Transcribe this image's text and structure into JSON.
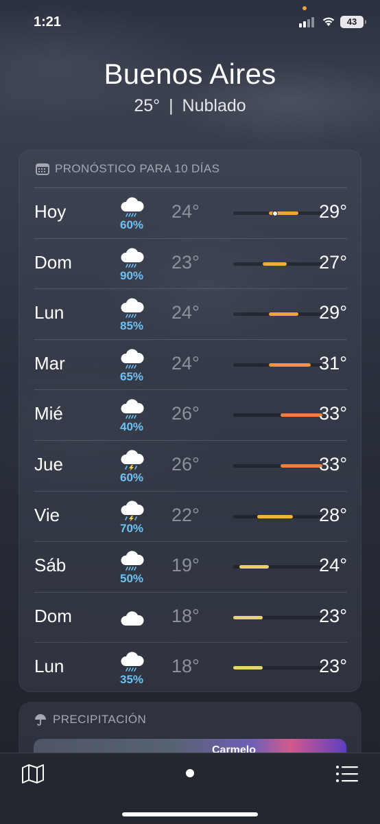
{
  "status_bar": {
    "time": "1:21",
    "battery": "43"
  },
  "header": {
    "city": "Buenos Aires",
    "temp": "25°",
    "separator": "|",
    "condition": "Nublado"
  },
  "forecast": {
    "title": "PRONÓSTICO PARA 10 DÍAS",
    "scale": {
      "min": 18,
      "max": 33
    },
    "days": [
      {
        "day": "Hoy",
        "icon": "rain-icon",
        "precip": "60%",
        "low": "24°",
        "high": "29°",
        "lo": 24,
        "hi": 29,
        "now": 25,
        "color": "#f2a23c"
      },
      {
        "day": "Dom",
        "icon": "rain-icon",
        "precip": "90%",
        "low": "23°",
        "high": "27°",
        "lo": 23,
        "hi": 27,
        "color": "#f3ad3a"
      },
      {
        "day": "Lun",
        "icon": "rain-icon",
        "precip": "85%",
        "low": "24°",
        "high": "29°",
        "lo": 24,
        "hi": 29,
        "color": "#f2a23c"
      },
      {
        "day": "Mar",
        "icon": "rain-icon",
        "precip": "65%",
        "low": "24°",
        "high": "31°",
        "lo": 24,
        "hi": 31,
        "color": "#f0963c"
      },
      {
        "day": "Mié",
        "icon": "rain-icon",
        "precip": "40%",
        "low": "26°",
        "high": "33°",
        "lo": 26,
        "hi": 33,
        "color": "#ee7f3c"
      },
      {
        "day": "Jue",
        "icon": "thunderstorm-icon",
        "precip": "60%",
        "low": "26°",
        "high": "33°",
        "lo": 26,
        "hi": 33,
        "color": "#ee7f3c"
      },
      {
        "day": "Vie",
        "icon": "thunderstorm-icon",
        "precip": "70%",
        "low": "22°",
        "high": "28°",
        "lo": 22,
        "hi": 28,
        "color": "#f4b23a"
      },
      {
        "day": "Sáb",
        "icon": "rain-icon",
        "precip": "50%",
        "low": "19°",
        "high": "24°",
        "lo": 19,
        "hi": 24,
        "color": "#e9d35c"
      },
      {
        "day": "Dom",
        "icon": "cloud-icon",
        "precip": "",
        "low": "18°",
        "high": "23°",
        "lo": 18,
        "hi": 23,
        "color": "#e6d56a"
      },
      {
        "day": "Lun",
        "icon": "rain-icon",
        "precip": "35%",
        "low": "18°",
        "high": "23°",
        "lo": 18,
        "hi": 23,
        "color": "#e6d56a"
      }
    ]
  },
  "precipitation": {
    "title": "PRECIPITACIÓN",
    "map_label": "Carmelo"
  },
  "toolbar": {
    "map_icon": "map-icon",
    "list_icon": "list-icon"
  }
}
